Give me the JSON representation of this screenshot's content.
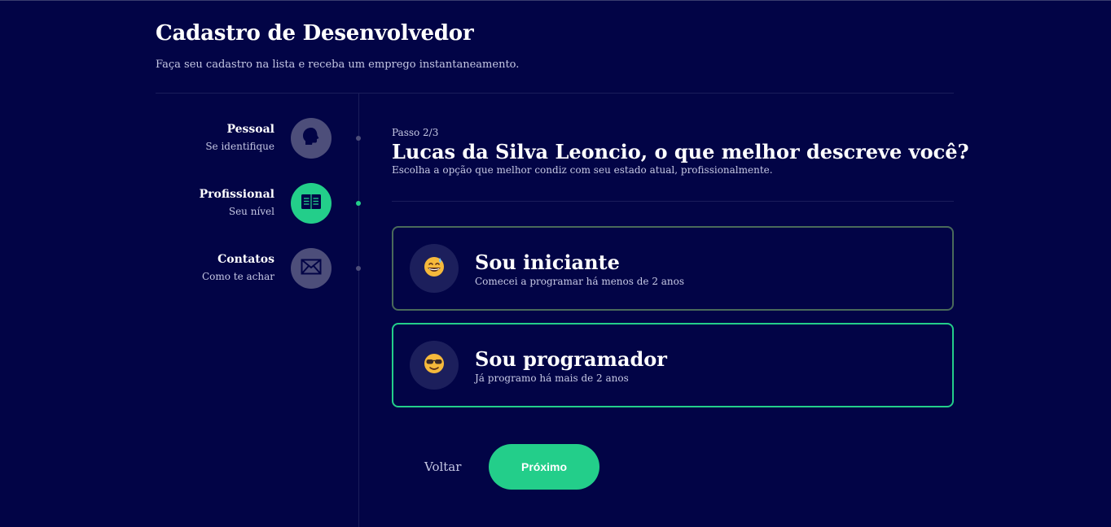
{
  "header": {
    "title": "Cadastro de Desenvolvedor",
    "subtitle": "Faça seu cadastro na lista e receba um emprego instantaneamento."
  },
  "steps": [
    {
      "title": "Pessoal",
      "subtitle": "Se identifique",
      "icon": "head-icon",
      "active": false
    },
    {
      "title": "Profissional",
      "subtitle": "Seu nível",
      "icon": "book-icon",
      "active": true
    },
    {
      "title": "Contatos",
      "subtitle": "Como te achar",
      "icon": "mail-icon",
      "active": false
    }
  ],
  "main": {
    "step_counter": "Passo 2/3",
    "question": "Lucas da Silva Leoncio, o que melhor descreve você?",
    "question_sub": "Escolha a opção que melhor condiz com seu estado atual, profissionalmente.",
    "options": [
      {
        "title": "Sou iniciante",
        "subtitle": "Comecei a programar há menos de 2 anos",
        "icon": "grinning-sweat-emoji-icon",
        "selected": false
      },
      {
        "title": "Sou programador",
        "subtitle": "Já programo há mais de 2 anos",
        "icon": "sunglasses-emoji-icon",
        "selected": true
      }
    ]
  },
  "actions": {
    "back_label": "Voltar",
    "next_label": "Próximo"
  },
  "colors": {
    "background": "#020446",
    "accent": "#23ce8a",
    "inactive_step": "#4d4e7a"
  }
}
